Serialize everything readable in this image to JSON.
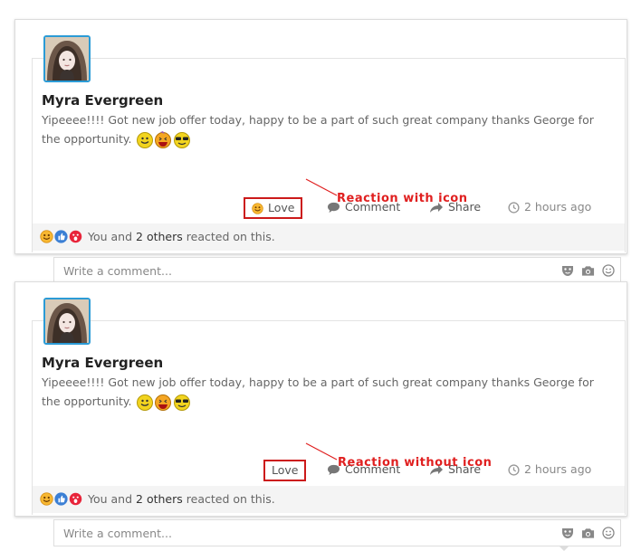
{
  "posts": [
    {
      "author": "Myra Evergreen",
      "text": "Yipeeee!!!! Got new job offer today, happy to be a part of such great company thanks George for the opportunity.",
      "actions": {
        "love": "Love",
        "comment": "Comment",
        "share": "Share",
        "time": "2 hours ago"
      },
      "reaction_prefix": "You and",
      "reaction_count": "2 others",
      "reaction_suffix": "reacted on this.",
      "comment_placeholder": "Write a comment...",
      "annotation": "Reaction with icon",
      "love_has_icon": true
    },
    {
      "author": "Myra Evergreen",
      "text": "Yipeeee!!!! Got new job offer today, happy to be a part of such great company thanks George for the opportunity.",
      "actions": {
        "love": "Love",
        "comment": "Comment",
        "share": "Share",
        "time": "2 hours ago"
      },
      "reaction_prefix": "You and",
      "reaction_count": "2 others",
      "reaction_suffix": "reacted on this.",
      "comment_placeholder": "Write a comment...",
      "annotation": "Reaction without icon",
      "love_has_icon": false
    }
  ],
  "colors": {
    "annotation": "#e02020",
    "avatar_border": "#2b9bd6",
    "like_blue": "#3b7fd4"
  },
  "icons": [
    "avatar-photo",
    "smile-emoji",
    "laugh-emoji",
    "cool-emoji",
    "love-emoji",
    "comment-icon",
    "share-icon",
    "clock-icon",
    "like-icon",
    "wow-emoji",
    "mask-icon",
    "camera-icon",
    "smiley-icon"
  ]
}
